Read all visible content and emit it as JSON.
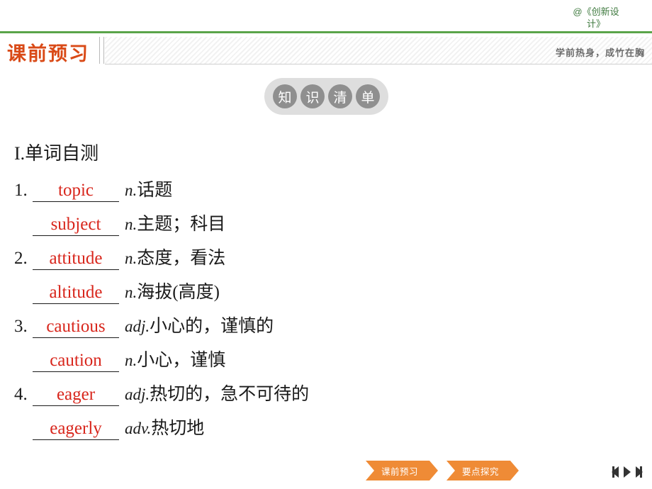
{
  "watermark": {
    "line1": "@《创新设",
    "line2": "计》"
  },
  "header": {
    "title": "课前预习",
    "subtitle": "学前热身，成竹在胸"
  },
  "section_pill": {
    "chars": [
      "知",
      "识",
      "清",
      "单"
    ]
  },
  "main": {
    "section_label": "I.单词自测",
    "entries": [
      {
        "number": "1.",
        "answer": "topic",
        "pos": "n.",
        "meaning": "话题",
        "indent": false
      },
      {
        "number": "",
        "answer": "subject",
        "pos": "n.",
        "meaning": "主题；科目",
        "indent": true
      },
      {
        "number": "2.",
        "answer": "attitude",
        "pos": "n.",
        "meaning": "态度，看法",
        "indent": false
      },
      {
        "number": "",
        "answer": "altitude",
        "pos": "n.",
        "meaning": "海拔(高度)",
        "indent": true
      },
      {
        "number": "3.",
        "answer": "cautious",
        "pos": "adj.",
        "meaning": "小心的，谨慎的",
        "indent": false
      },
      {
        "number": "",
        "answer": "caution",
        "pos": "n.",
        "meaning": "小心，谨慎",
        "indent": true
      },
      {
        "number": "4.",
        "answer": "eager",
        "pos": "adj.",
        "meaning": "热切的，急不可待的",
        "indent": false
      },
      {
        "number": "",
        "answer": "eagerly",
        "pos": "adv.",
        "meaning": "热切地",
        "indent": true
      }
    ]
  },
  "footer": {
    "tabs": [
      {
        "label": "课前预习"
      },
      {
        "label": "要点探究"
      }
    ],
    "nav": {
      "first": "first-page",
      "prev": "previous-page",
      "next": "next-page",
      "last": "last-page"
    }
  },
  "colors": {
    "accent_green": "#5aa44a",
    "header_red": "#d94a17",
    "answer_red": "#d8261c",
    "tab_orange": "#ef8b36"
  }
}
